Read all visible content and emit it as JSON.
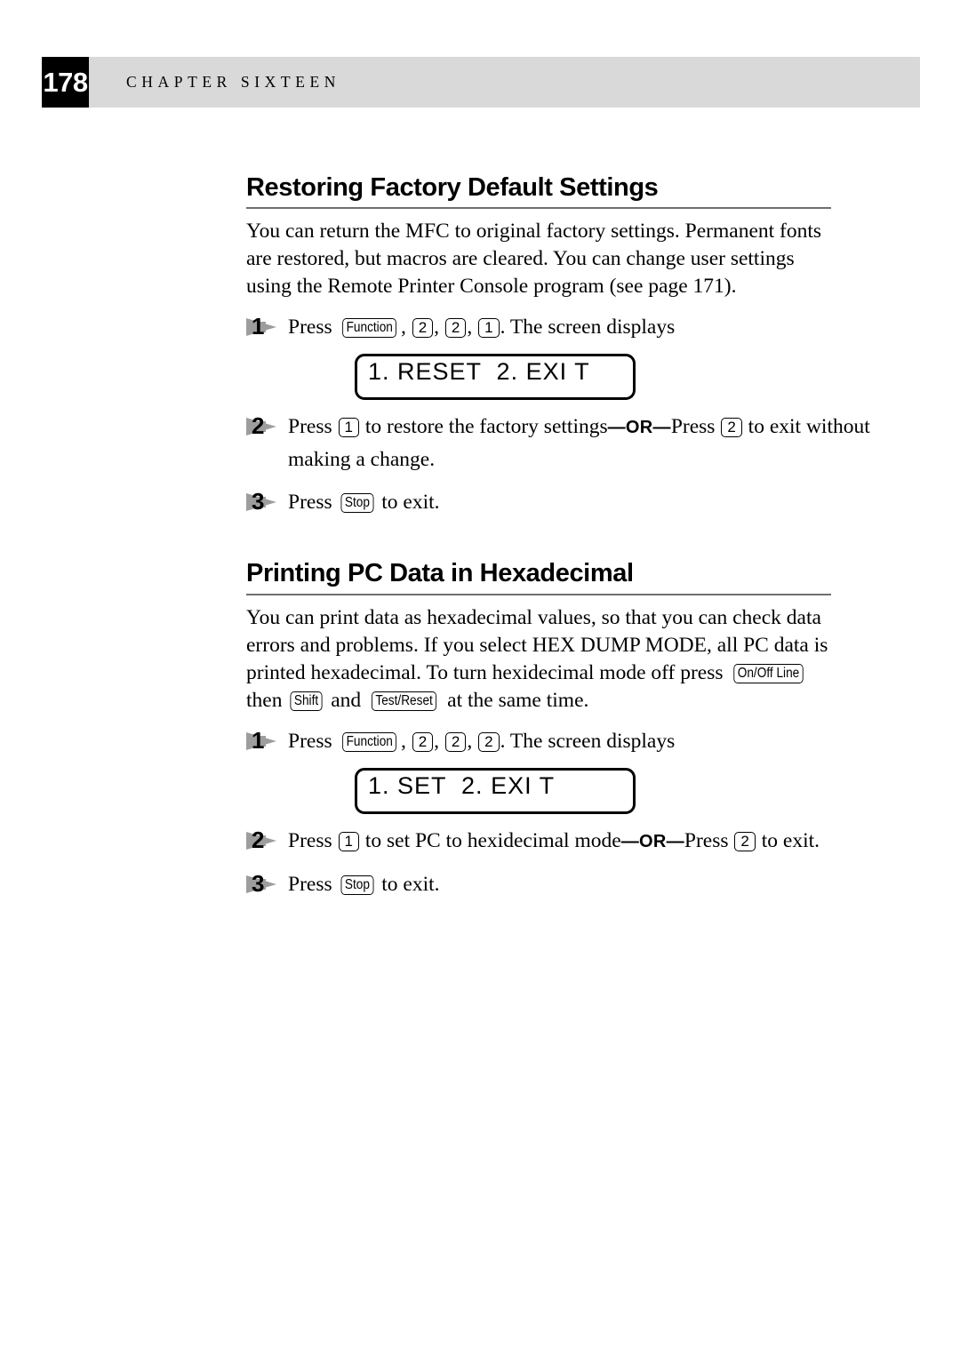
{
  "header": {
    "page_number": "178",
    "chapter_label": "CHAPTER  SIXTEEN",
    "band_color": "#d9d9d9",
    "box_color": "#000000"
  },
  "sections": [
    {
      "id": "restoring-factory-default-settings",
      "title": "Restoring Factory Default Settings",
      "intro": "You can return the MFC to original factory settings.  Permanent fonts are restored, but macros are cleared.  You can change user settings using the Remote Printer Console program (see page 171).",
      "steps": [
        {
          "number": "1",
          "text_before_keys": "Press ",
          "keys": [
            "Function",
            "2",
            "2",
            "1"
          ],
          "text_after_keys": ". The screen displays"
        },
        {
          "number": "2",
          "part1": "Press ",
          "key1": "1",
          "part2": " to restore the factory settings",
          "or": "—OR—",
          "part3": "Press ",
          "key2": "2",
          "part4": " to exit without making a change."
        },
        {
          "number": "3",
          "part1": "Press ",
          "key1": "Stop",
          "part2": " to exit."
        }
      ],
      "lcd": "1. RESET  2. EXI T"
    },
    {
      "id": "printing-pc-data-in-hexadecimal",
      "title": "Printing PC Data in Hexadecimal",
      "intro_part1": "You can print data as hexadecimal values, so that you can check data errors and problems. If you select HEX DUMP MODE, all PC data is printed hexadecimal. To turn hexidecimal mode off press ",
      "intro_key1": "On/Off Line",
      "intro_part2": " then ",
      "intro_key2": "Shift",
      "intro_part3": " and ",
      "intro_key3": "Test/Reset",
      "intro_part4": " at the same time.",
      "steps": [
        {
          "number": "1",
          "text_before_keys": "Press ",
          "keys": [
            "Function",
            "2",
            "2",
            "2"
          ],
          "text_after_keys": ".  The screen displays"
        },
        {
          "number": "2",
          "part1": "Press ",
          "key1": "1",
          "part2": " to set PC to hexidecimal mode",
          "or": "—OR—",
          "part3": "Press ",
          "key2": "2",
          "part4": " to exit."
        },
        {
          "number": "3",
          "part1": "Press ",
          "key1": "Stop",
          "part2": " to exit."
        }
      ],
      "lcd": "1. SET  2. EXI T"
    }
  ]
}
